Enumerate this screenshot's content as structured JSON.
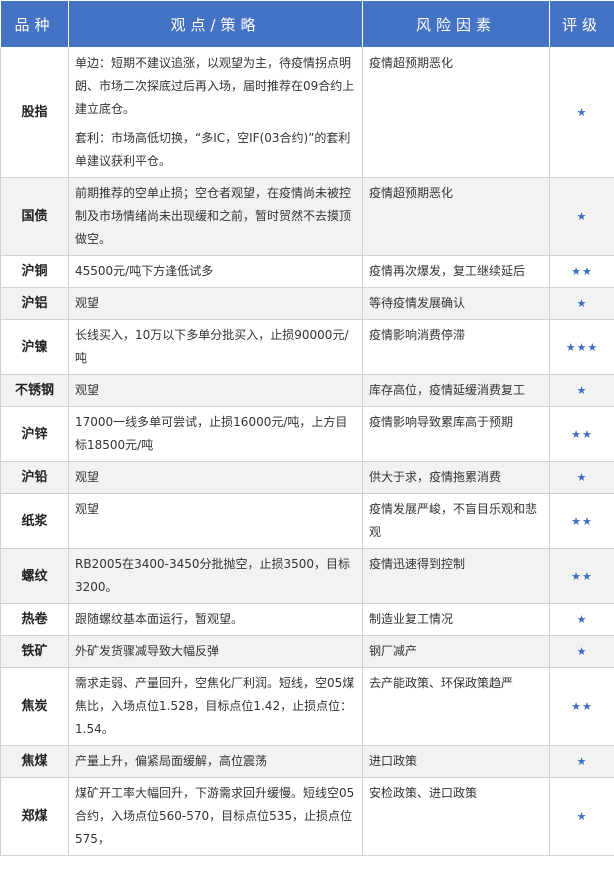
{
  "header": {
    "col_variety": "品种",
    "col_view": "观点/策略",
    "col_risk": "风险因素",
    "col_rating": "评级"
  },
  "rows": [
    {
      "name": "股指",
      "view": [
        "单边：短期不建议追涨，以观望为主，待疫情拐点明朗、市场二次探底过后再入场，届时推荐在09合约上建立底仓。",
        "套利：市场高低切换，“多IC，空IF(03合约)”的套利单建议获利平仓。"
      ],
      "risk": "疫情超预期恶化",
      "rating": "★"
    },
    {
      "name": "国债",
      "view": [
        "前期推荐的空单止损；空仓者观望，在疫情尚未被控制及市场情绪尚未出现缓和之前，暂时贸然不去摸顶做空。"
      ],
      "risk": "疫情超预期恶化",
      "rating": "★"
    },
    {
      "name": "沪铜",
      "view": [
        "45500元/吨下方逢低试多"
      ],
      "risk": "疫情再次爆发，复工继续延后",
      "rating": "★★"
    },
    {
      "name": "沪铝",
      "view": [
        "观望"
      ],
      "risk": "等待疫情发展确认",
      "rating": "★"
    },
    {
      "name": "沪镍",
      "view": [
        "长线买入，10万以下多单分批买入，止损90000元/吨"
      ],
      "risk": "疫情影响消费停滞",
      "rating": "★★★"
    },
    {
      "name": "不锈钢",
      "view": [
        "观望"
      ],
      "risk": "库存高位，疫情延缓消费复工",
      "rating": "★"
    },
    {
      "name": "沪锌",
      "view": [
        "17000一线多单可尝试，止损16000元/吨，上方目标18500元/吨"
      ],
      "risk": "疫情影响导致累库高于预期",
      "rating": "★★"
    },
    {
      "name": "沪铅",
      "view": [
        "观望"
      ],
      "risk": "供大于求，疫情拖累消费",
      "rating": "★"
    },
    {
      "name": "纸浆",
      "view": [
        "观望"
      ],
      "risk": "疫情发展严峻，不盲目乐观和悲观",
      "rating": "★★"
    },
    {
      "name": "螺纹",
      "view": [
        "RB2005在3400-3450分批抛空，止损3500，目标3200。"
      ],
      "risk": "疫情迅速得到控制",
      "rating": "★★"
    },
    {
      "name": "热卷",
      "view": [
        "跟随螺纹基本面运行，暂观望。"
      ],
      "risk": "制造业复工情况",
      "rating": "★"
    },
    {
      "name": "铁矿",
      "view": [
        "外矿发货骤减导致大幅反弹"
      ],
      "risk": "钢厂减产",
      "rating": "★"
    },
    {
      "name": "焦炭",
      "view": [
        "需求走弱、产量回升，空焦化厂利润。短线，空05煤焦比，入场点位1.528，目标点位1.42，止损点位：1.54。"
      ],
      "risk": "去产能政策、环保政策趋严",
      "rating": "★★"
    },
    {
      "name": "焦煤",
      "view": [
        "产量上升，偏紧局面缓解，高位震荡"
      ],
      "risk": "进口政策",
      "rating": "★"
    },
    {
      "name": "郑煤",
      "view": [
        "煤矿开工率大幅回升，下游需求回升缓慢。短线空05合约，入场点位560-570，目标点位535，止损点位575，"
      ],
      "risk": "安检政策、进口政策",
      "rating": "★"
    }
  ]
}
